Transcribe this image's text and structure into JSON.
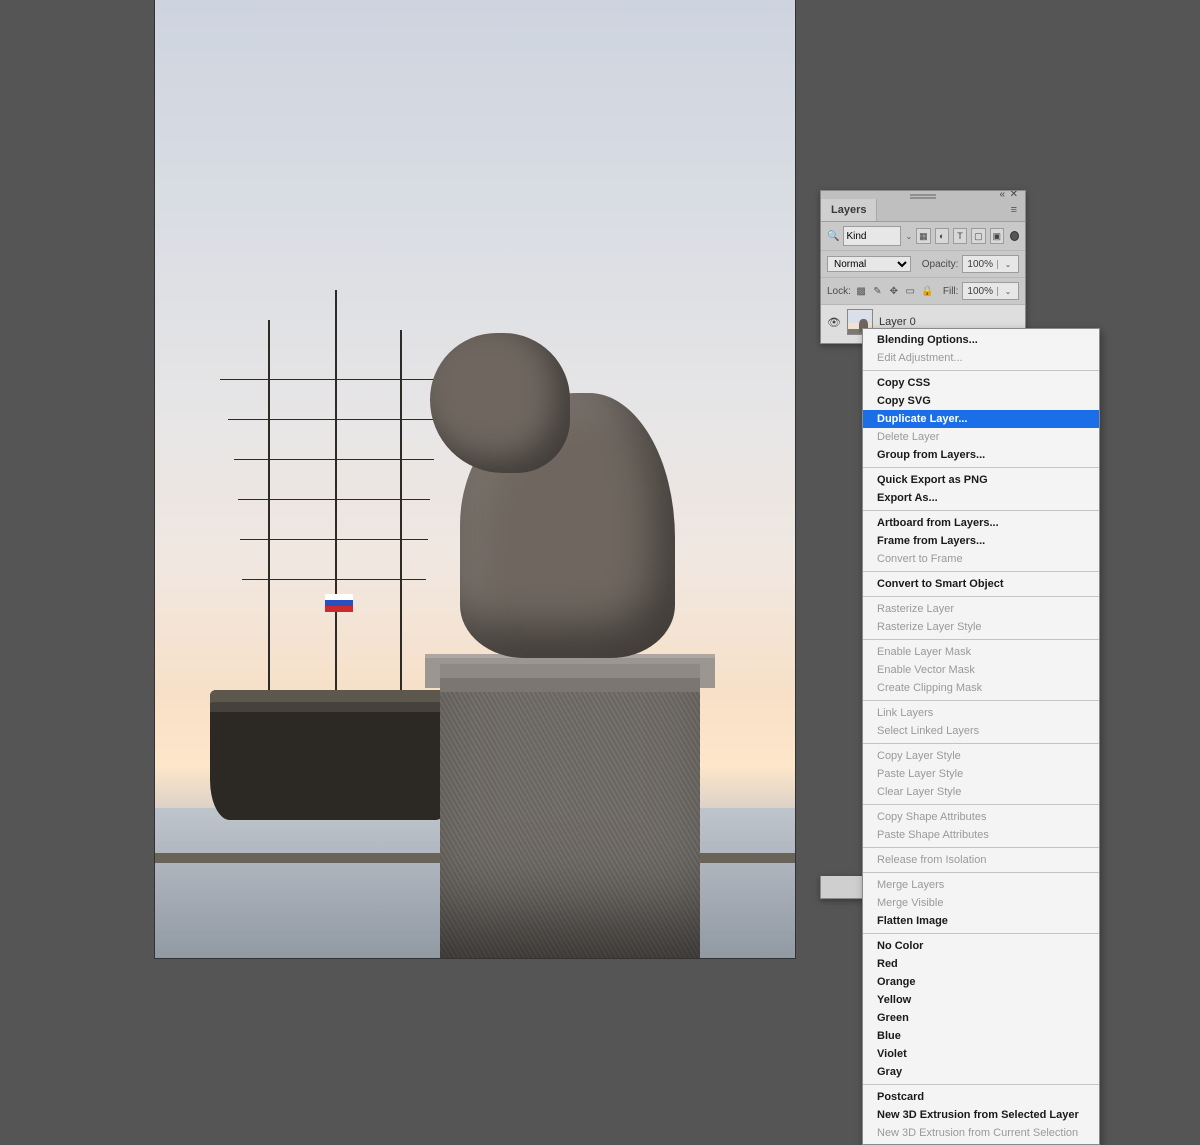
{
  "layers_panel": {
    "tab_label": "Layers",
    "kind_label": "Kind",
    "blend_mode": "Normal",
    "opacity_label": "Opacity:",
    "opacity_value": "100%",
    "lock_label": "Lock:",
    "fill_label": "Fill:",
    "fill_value": "100%",
    "layer_name": "Layer 0"
  },
  "context_menu": {
    "groups": [
      [
        {
          "label": "Blending Options...",
          "bold": true,
          "disabled": false
        },
        {
          "label": "Edit Adjustment...",
          "bold": false,
          "disabled": true
        }
      ],
      [
        {
          "label": "Copy CSS",
          "bold": true,
          "disabled": false
        },
        {
          "label": "Copy SVG",
          "bold": true,
          "disabled": false
        },
        {
          "label": "Duplicate Layer...",
          "bold": true,
          "disabled": false,
          "selected": true
        },
        {
          "label": "Delete Layer",
          "bold": false,
          "disabled": true
        },
        {
          "label": "Group from Layers...",
          "bold": true,
          "disabled": false
        }
      ],
      [
        {
          "label": "Quick Export as PNG",
          "bold": true,
          "disabled": false
        },
        {
          "label": "Export As...",
          "bold": true,
          "disabled": false
        }
      ],
      [
        {
          "label": "Artboard from Layers...",
          "bold": true,
          "disabled": false
        },
        {
          "label": "Frame from Layers...",
          "bold": true,
          "disabled": false
        },
        {
          "label": "Convert to Frame",
          "bold": false,
          "disabled": true
        }
      ],
      [
        {
          "label": "Convert to Smart Object",
          "bold": true,
          "disabled": false
        }
      ],
      [
        {
          "label": "Rasterize Layer",
          "bold": false,
          "disabled": true
        },
        {
          "label": "Rasterize Layer Style",
          "bold": false,
          "disabled": true
        }
      ],
      [
        {
          "label": "Enable Layer Mask",
          "bold": false,
          "disabled": true
        },
        {
          "label": "Enable Vector Mask",
          "bold": false,
          "disabled": true
        },
        {
          "label": "Create Clipping Mask",
          "bold": false,
          "disabled": true
        }
      ],
      [
        {
          "label": "Link Layers",
          "bold": false,
          "disabled": true
        },
        {
          "label": "Select Linked Layers",
          "bold": false,
          "disabled": true
        }
      ],
      [
        {
          "label": "Copy Layer Style",
          "bold": false,
          "disabled": true
        },
        {
          "label": "Paste Layer Style",
          "bold": false,
          "disabled": true
        },
        {
          "label": "Clear Layer Style",
          "bold": false,
          "disabled": true
        }
      ],
      [
        {
          "label": "Copy Shape Attributes",
          "bold": false,
          "disabled": true
        },
        {
          "label": "Paste Shape Attributes",
          "bold": false,
          "disabled": true
        }
      ],
      [
        {
          "label": "Release from Isolation",
          "bold": false,
          "disabled": true
        }
      ],
      [
        {
          "label": "Merge Layers",
          "bold": false,
          "disabled": true
        },
        {
          "label": "Merge Visible",
          "bold": false,
          "disabled": true
        },
        {
          "label": "Flatten Image",
          "bold": true,
          "disabled": false
        }
      ],
      [
        {
          "label": "No Color",
          "bold": true,
          "disabled": false
        },
        {
          "label": "Red",
          "bold": true,
          "disabled": false
        },
        {
          "label": "Orange",
          "bold": true,
          "disabled": false
        },
        {
          "label": "Yellow",
          "bold": true,
          "disabled": false
        },
        {
          "label": "Green",
          "bold": true,
          "disabled": false
        },
        {
          "label": "Blue",
          "bold": true,
          "disabled": false
        },
        {
          "label": "Violet",
          "bold": true,
          "disabled": false
        },
        {
          "label": "Gray",
          "bold": true,
          "disabled": false
        }
      ],
      [
        {
          "label": "Postcard",
          "bold": true,
          "disabled": false
        },
        {
          "label": "New 3D Extrusion from Selected Layer",
          "bold": true,
          "disabled": false
        },
        {
          "label": "New 3D Extrusion from Current Selection",
          "bold": false,
          "disabled": true
        }
      ]
    ]
  }
}
